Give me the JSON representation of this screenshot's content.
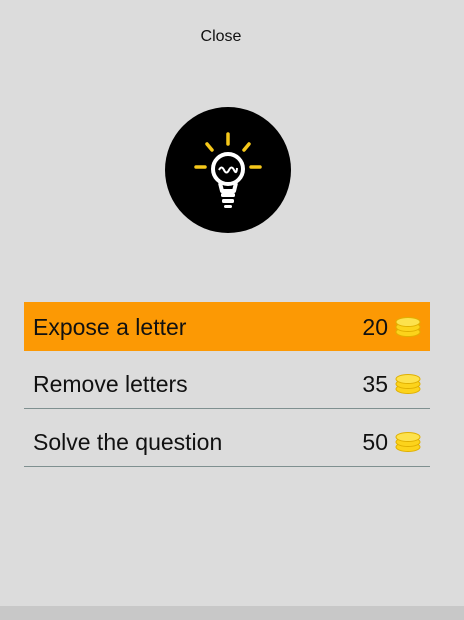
{
  "dialog": {
    "close_label": "Close"
  },
  "options": [
    {
      "label": "Expose a letter",
      "price": "20",
      "highlighted": true
    },
    {
      "label": "Remove letters",
      "price": "35",
      "highlighted": false
    },
    {
      "label": "Solve the question",
      "price": "50",
      "highlighted": false
    }
  ],
  "colors": {
    "background": "#dcdcdc",
    "highlight": "#fc9904",
    "coin": "#fcd31b",
    "bulb_rays": "#f6c81a"
  },
  "icons": {
    "hint": "lightbulb-icon",
    "currency": "coin-stack-icon"
  }
}
